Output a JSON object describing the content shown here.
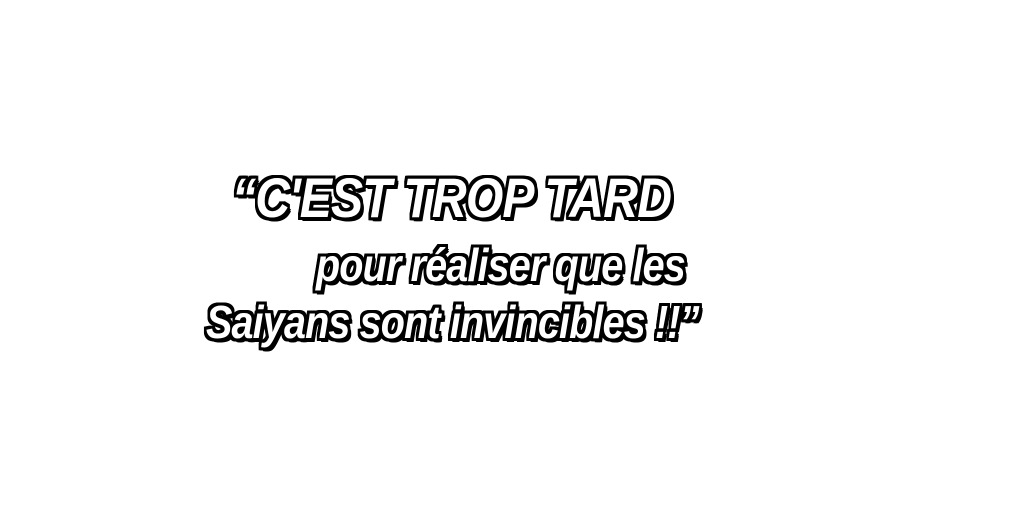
{
  "quote": {
    "line_1": "“C'EST TROP TARD",
    "line_2": "pour réaliser que les",
    "line_3": "Saiyans sont invincibles !!”"
  }
}
